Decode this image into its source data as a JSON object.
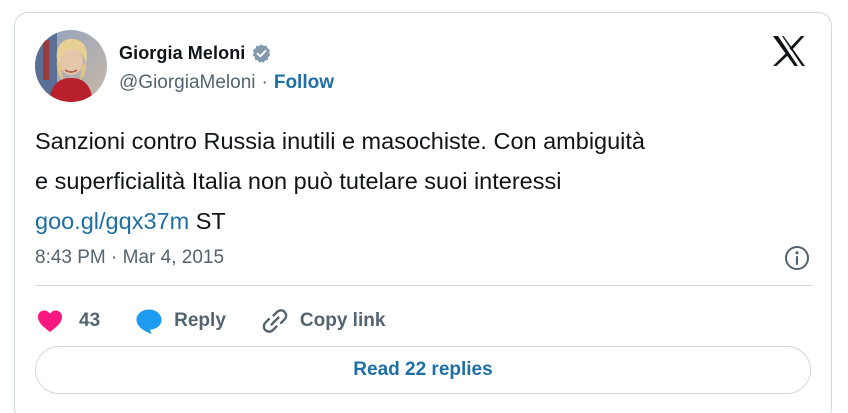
{
  "author": {
    "display_name": "Giorgia Meloni",
    "handle": "@GiorgiaMeloni",
    "separator": "·",
    "follow_label": "Follow",
    "verified_icon": "verified-badge-icon",
    "avatar_icon": "avatar"
  },
  "brand": {
    "logo_icon": "x-logo-icon"
  },
  "tweet": {
    "text_line1": "Sanzioni contro Russia inutili e masochiste. Con ambiguità",
    "text_line2": "e superficialità Italia non può tutelare suoi interessi",
    "link_text": "goo.gl/gqx37m",
    "text_suffix": " ST"
  },
  "meta": {
    "timestamp": "8:43 PM · Mar 4, 2015",
    "info_icon": "info-icon"
  },
  "actions": {
    "like_count": "43",
    "like_icon": "heart-icon",
    "reply_label": "Reply",
    "reply_icon": "speech-bubble-icon",
    "copy_label": "Copy link",
    "copy_icon": "chain-link-icon"
  },
  "footer": {
    "read_replies_label": "Read 22 replies"
  },
  "colors": {
    "link_blue": "#1d6fa5",
    "like_pink": "#f91880",
    "reply_blue": "#1d9bf0",
    "muted_text": "#536471",
    "border": "#cfd9de"
  }
}
